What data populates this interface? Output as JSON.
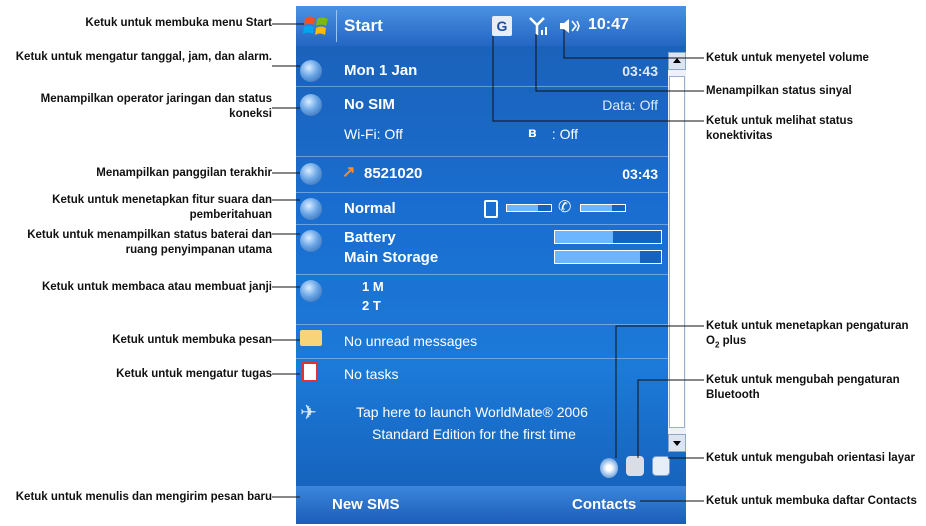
{
  "titlebar": {
    "start_label": "Start",
    "clock": "10:47",
    "connectivity_letter": "G"
  },
  "today": {
    "date": "Mon 1 Jan",
    "alarm_time": "03:43",
    "operator": "No SIM",
    "data_status": "Data: Off",
    "wifi": "Wi-Fi: Off",
    "bluetooth": ": Off",
    "last_call_number": "8521020",
    "last_call_time": "03:43",
    "profile": "Normal",
    "battery_label": "Battery",
    "storage_label": "Main Storage",
    "battery_level": 0.55,
    "storage_level": 0.8,
    "ringer_level": 0.7,
    "phone_volume_level": 0.7,
    "appointments": [
      "1 M",
      "2 T"
    ],
    "messages": "No unread messages",
    "tasks": "No tasks",
    "worldmate_line1": "Tap here to launch WorldMate® 2006",
    "worldmate_line2": "Standard Edition for the first time"
  },
  "softkeys": {
    "left": "New SMS",
    "right": "Contacts"
  },
  "callouts_left": [
    "Ketuk untuk membuka menu Start",
    "Ketuk untuk mengatur tanggal, jam, dan alarm.",
    "Menampilkan operator jaringan dan status koneksi",
    "Menampilkan panggilan terakhir",
    "Ketuk untuk menetapkan fitur suara dan pemberitahuan",
    "Ketuk untuk menampilkan status baterai dan ruang penyimpanan utama",
    "Ketuk untuk membaca atau membuat janji",
    "Ketuk untuk membuka pesan",
    "Ketuk untuk mengatur tugas",
    "Ketuk untuk menulis dan mengirim pesan baru"
  ],
  "callouts_right": [
    "Ketuk untuk menyetel volume",
    "Menampilkan status sinyal",
    "Ketuk untuk melihat status konektivitas",
    "Ketuk untuk menetapkan pengaturan O",
    "Ketuk untuk mengubah pengaturan Bluetooth",
    "Ketuk untuk mengubah orientasi layar",
    "Ketuk untuk membuka daftar Contacts"
  ],
  "callout_o2_sub": "2",
  "callout_o2_tail": " plus",
  "colors": {
    "screen_blue": "#1a6ed0",
    "titlebar_blue": "#2466c4",
    "bar_fill": "#6bb6ff"
  }
}
